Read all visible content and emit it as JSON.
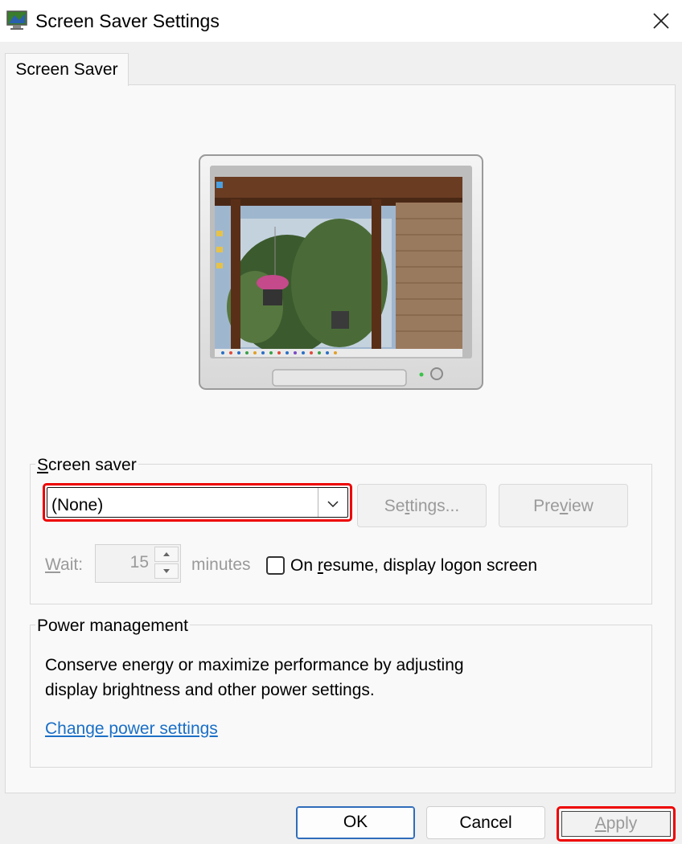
{
  "window": {
    "title": "Screen Saver Settings",
    "icon": "screen-saver-app-icon",
    "close_icon": "close-icon"
  },
  "tabs": [
    {
      "label": "Screen Saver",
      "selected": true
    }
  ],
  "screen_saver_group": {
    "label": "Screen saver",
    "selected_value": "(None)",
    "settings_button": "Settings...",
    "preview_button": "Preview",
    "wait_label": "Wait:",
    "wait_value": "15",
    "minutes_label": "minutes",
    "resume_checkbox_label": "On resume, display logon screen",
    "resume_checked": false
  },
  "power_group": {
    "label": "Power management",
    "description_line1": "Conserve energy or maximize performance by adjusting",
    "description_line2": "display brightness and other power settings.",
    "link": "Change power settings"
  },
  "buttons": {
    "ok": "OK",
    "cancel": "Cancel",
    "apply": "Apply"
  },
  "colors": {
    "highlight": "#e00000",
    "link": "#1a6fc6",
    "ok_border": "#2f6cba",
    "disabled_text": "#9a9a9a"
  }
}
